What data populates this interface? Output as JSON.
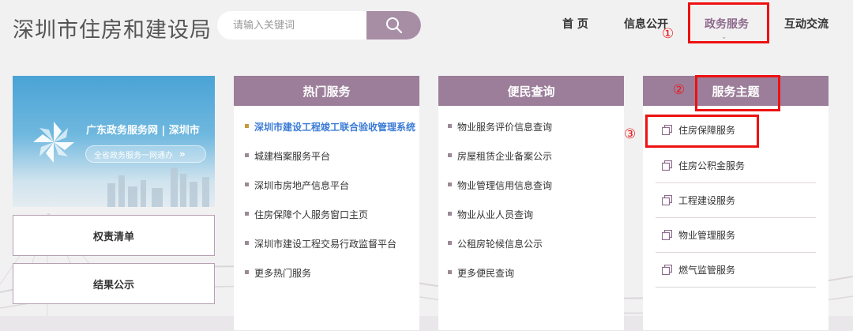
{
  "header": {
    "site_title": "深圳市住房和建设局",
    "search_placeholder": "请输入关键词",
    "nav": {
      "home": "首 页",
      "info": "信息公开",
      "service": "政务服务",
      "interact": "互动交流"
    }
  },
  "banner": {
    "title": "广东政务服务网 | 深圳市",
    "pill": "全省政务服务一网通办",
    "pill_arrow": "»"
  },
  "side_buttons": {
    "power_list": "权责清单",
    "result_notice": "结果公示"
  },
  "hot_services": {
    "title": "热门服务",
    "items": [
      "深圳市建设工程竣工联合验收管理系统",
      "城建档案服务平台",
      "深圳市房地产信息平台",
      "住房保障个人服务窗口主页",
      "深圳市建设工程交易行政监督平台",
      "更多热门服务"
    ]
  },
  "public_query": {
    "title": "便民查询",
    "items": [
      "物业服务评价信息查询",
      "房屋租赁企业备案公示",
      "物业管理信用信息查询",
      "物业从业人员查询",
      "公租房轮候信息公示",
      "更多便民查询"
    ]
  },
  "service_themes": {
    "title": "服务主题",
    "items": [
      "住房保障服务",
      "住房公积金服务",
      "工程建设服务",
      "物业管理服务",
      "燃气监管服务"
    ]
  },
  "annotations": {
    "one": "①",
    "two": "②",
    "three": "③"
  },
  "colors": {
    "accent_purple": "#9c7e9a",
    "highlight_blue": "#3b7bd6",
    "annotation_red": "#ee1111"
  }
}
